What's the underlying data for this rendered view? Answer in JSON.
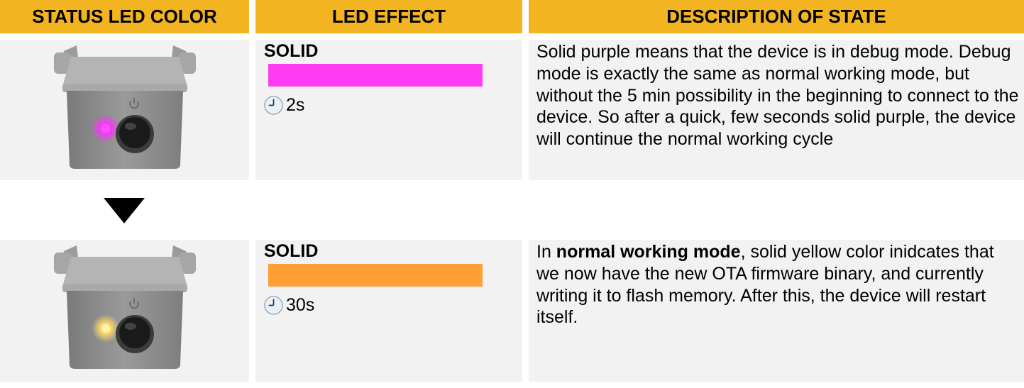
{
  "headers": {
    "col1": "STATUS LED COLOR",
    "col2": "LED EFFECT",
    "col3": "DESCRIPTION OF STATE"
  },
  "colors": {
    "header_bg": "#f2b420",
    "cell_bg": "#f2f2f2",
    "purple_led": "#ff3cf4",
    "yellow_led": "#ff9f36"
  },
  "rows": [
    {
      "led_icon": "device-purple-led-icon",
      "effect": "SOLID",
      "duration": "2s",
      "bar_color": "#ff3cf4",
      "description": "Solid purple means that the device is in debug mode. Debug mode is exactly the same as normal working mode, but without the 5 min possibility in the beginning to connect to the device. So after a quick, few seconds solid purple, the device will continue the normal working cycle"
    },
    {
      "led_icon": "device-yellow-led-icon",
      "effect": "SOLID",
      "duration": "30s",
      "bar_color": "#ff9f36",
      "description_prefix": "In ",
      "description_bold": "normal working mode",
      "description_suffix": ", solid yellow color inidcates that we now have the new OTA firmware binary, and currently writing it to flash memory. After this, the device will restart itself."
    }
  ]
}
